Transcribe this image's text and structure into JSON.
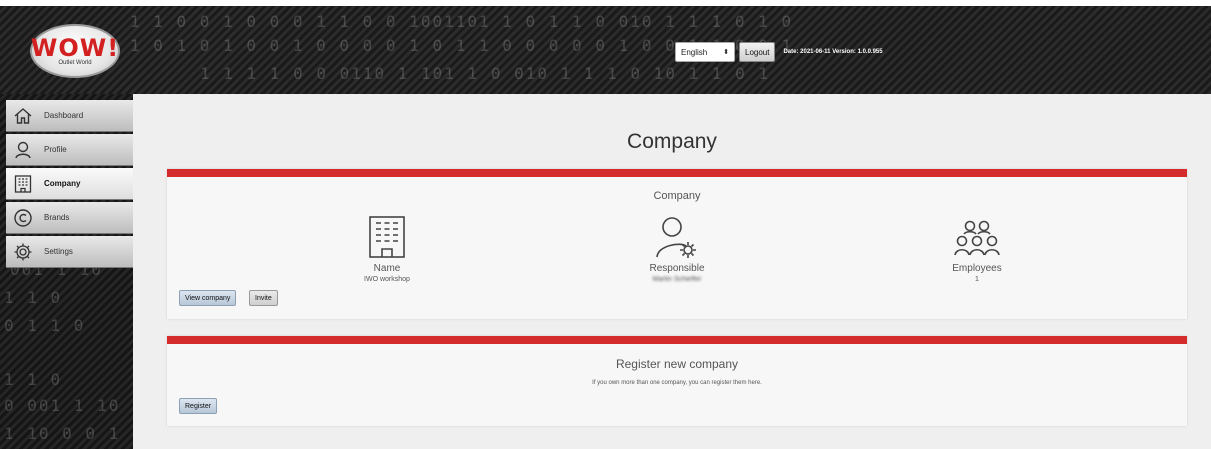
{
  "header": {
    "logo_text": "WOW!",
    "logo_subtext": "Outlet World",
    "language": "English",
    "logout_label": "Logout",
    "date_label": "Date:",
    "date_value": "2021-06-11",
    "version_label": "Version:",
    "version_value": "1.0.0.955",
    "binary_lines": [
      "1 1   0   0 1  0  0 0 1 1 0      0 1001101 1 0 1 1  0 010    1   1 1   0 1 0",
      "1 0 1 0 1  0      0 1 0        0 0 0 1 0 1 1 0      0 0 0 0 1 0  0 1 1 0 0 1",
      "1 1 1 1 0  0   0110 1 101 1 0 010    1   1 1   0 10 1   1 0 1"
    ]
  },
  "sidebar": {
    "items": [
      {
        "label": "Dashboard",
        "icon": "home-icon"
      },
      {
        "label": "Profile",
        "icon": "person-icon"
      },
      {
        "label": "Company",
        "icon": "building-icon",
        "active": true
      },
      {
        "label": "Brands",
        "icon": "copyright-icon"
      },
      {
        "label": "Settings",
        "icon": "gear-icon"
      }
    ],
    "binary_lines": [
      "001 1 10",
      "1 1     0",
      "0 1 1 0",
      "1 1    0",
      "0  001 1 10",
      "1 10  0 0 1 1"
    ]
  },
  "main": {
    "page_title": "Company",
    "company_card": {
      "title": "Company",
      "name_label": "Name",
      "name_value": "IWO workshop",
      "responsible_label": "Responsible",
      "responsible_value": "Martin Schieffer",
      "employees_label": "Employees",
      "employees_value": "1",
      "view_button": "View company",
      "invite_button": "Invite"
    },
    "register_card": {
      "title": "Register new company",
      "description": "If you own more than one company, you can register them here.",
      "register_button": "Register"
    }
  },
  "colors": {
    "accent_red": "#d42c2c",
    "button_blue": "#c8d6e5"
  }
}
